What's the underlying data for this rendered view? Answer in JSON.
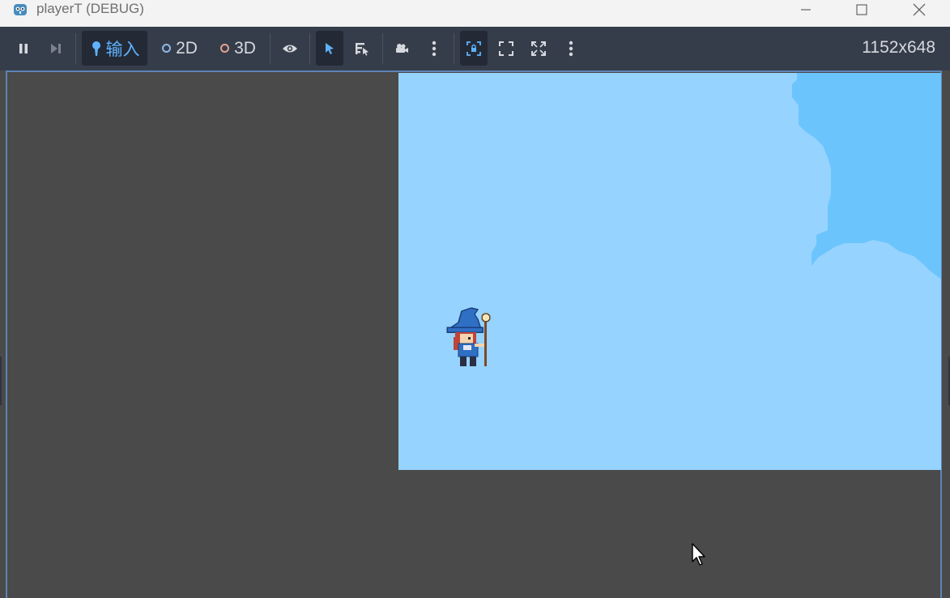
{
  "window": {
    "title": "playerT (DEBUG)",
    "controls": [
      "minimize-icon",
      "maximize-icon",
      "close-icon"
    ]
  },
  "toolbar": {
    "pause_icon": "pause-icon",
    "step_icon": "next-frame-icon",
    "input_label": "输入",
    "mode_2d_label": "2D",
    "mode_3d_label": "3D",
    "resolution": "1152x648"
  },
  "colors": {
    "accent": "#5d85b6",
    "sky": "#96d3fe",
    "cloud_shadow": "#6cc4fd",
    "toolbar_bg": "#363d4a",
    "canvas_bg": "#4a4a4a"
  }
}
